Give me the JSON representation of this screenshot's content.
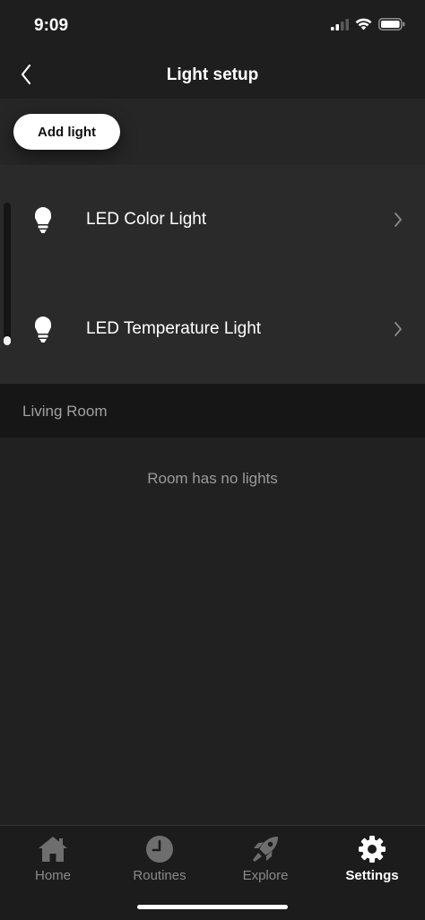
{
  "status_bar": {
    "time": "9:09"
  },
  "nav": {
    "title": "Light setup"
  },
  "actions": {
    "add_light_label": "Add light"
  },
  "lights": [
    {
      "label": "LED Color Light",
      "icon": "bulb-icon"
    },
    {
      "label": "LED Temperature Light",
      "icon": "bulb-icon"
    }
  ],
  "brightness": {
    "level_fraction": 0.05
  },
  "room": {
    "name": "Living Room",
    "empty_message": "Room has no lights"
  },
  "tabs": [
    {
      "label": "Home",
      "icon": "home-icon",
      "active": false
    },
    {
      "label": "Routines",
      "icon": "clock-icon",
      "active": false
    },
    {
      "label": "Explore",
      "icon": "rocket-icon",
      "active": false
    },
    {
      "label": "Settings",
      "icon": "gear-icon",
      "active": true
    }
  ],
  "colors": {
    "background": "#212121",
    "row": "#2a2a2a",
    "accent": "#ffffff",
    "muted_text": "#9a9a9a"
  }
}
